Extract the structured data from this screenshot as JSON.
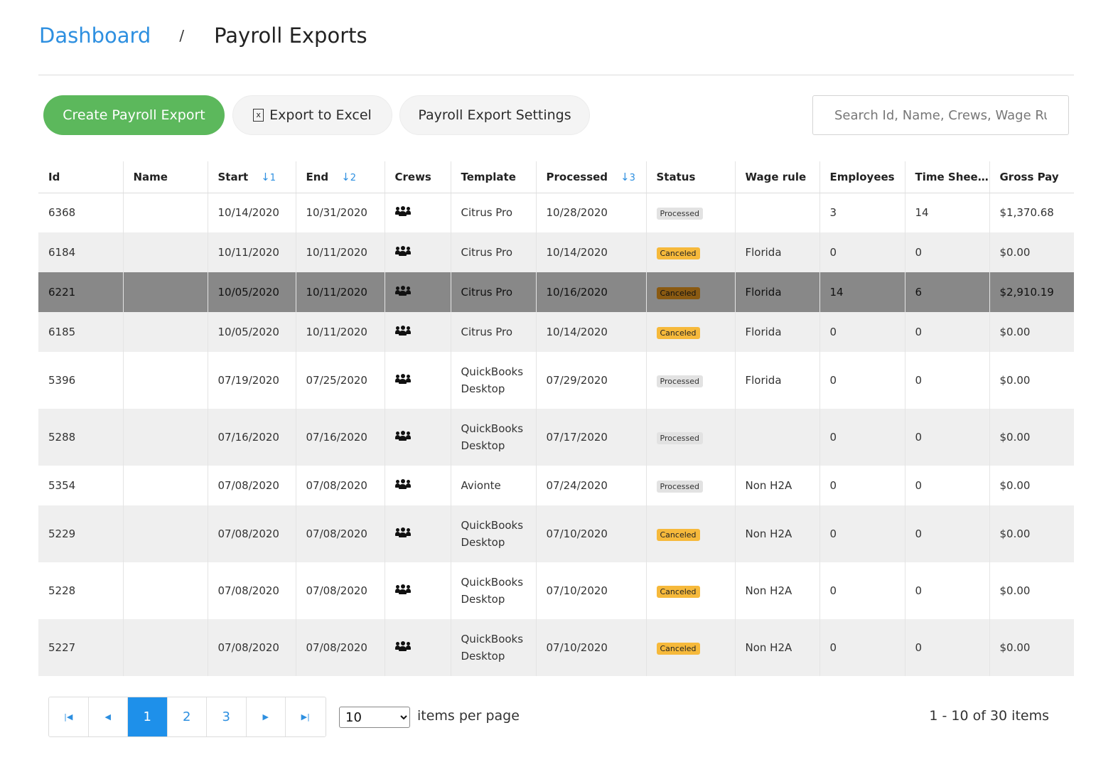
{
  "breadcrumb": {
    "root": "Dashboard",
    "separator": "/",
    "current": "Payroll Exports"
  },
  "toolbar": {
    "create_label": "Create Payroll Export",
    "excel_label": "Export to Excel",
    "excel_icon": "excel-file-icon",
    "settings_label": "Payroll Export Settings",
    "search_placeholder": "Search Id, Name, Crews, Wage Rule"
  },
  "table": {
    "columns": [
      "Id",
      "Name",
      "Start",
      "End",
      "Crews",
      "Template",
      "Processed",
      "Status",
      "Wage rule",
      "Employees",
      "Time Shee...",
      "Gross Pay"
    ],
    "sort": {
      "start": "1",
      "end": "2",
      "processed": "3"
    },
    "crew_icon": "users-icon",
    "rows": [
      {
        "id": "6368",
        "name": "",
        "start": "10/14/2020",
        "end": "10/31/2020",
        "template": [
          "Citrus Pro"
        ],
        "processed": "10/28/2020",
        "status": "Processed",
        "wage_rule": "",
        "employees": "3",
        "timesheets": "14",
        "gross_pay": "$1,370.68"
      },
      {
        "id": "6184",
        "name": "",
        "start": "10/11/2020",
        "end": "10/11/2020",
        "template": [
          "Citrus Pro"
        ],
        "processed": "10/14/2020",
        "status": "Canceled",
        "wage_rule": "Florida",
        "employees": "0",
        "timesheets": "0",
        "gross_pay": "$0.00"
      },
      {
        "id": "6221",
        "name": "",
        "start": "10/05/2020",
        "end": "10/11/2020",
        "template": [
          "Citrus Pro"
        ],
        "processed": "10/16/2020",
        "status": "Canceled",
        "wage_rule": "Florida",
        "employees": "14",
        "timesheets": "6",
        "gross_pay": "$2,910.19"
      },
      {
        "id": "6185",
        "name": "",
        "start": "10/05/2020",
        "end": "10/11/2020",
        "template": [
          "Citrus Pro"
        ],
        "processed": "10/14/2020",
        "status": "Canceled",
        "wage_rule": "Florida",
        "employees": "0",
        "timesheets": "0",
        "gross_pay": "$0.00"
      },
      {
        "id": "5396",
        "name": "",
        "start": "07/19/2020",
        "end": "07/25/2020",
        "template": [
          "QuickBooks",
          "Desktop"
        ],
        "processed": "07/29/2020",
        "status": "Processed",
        "wage_rule": "Florida",
        "employees": "0",
        "timesheets": "0",
        "gross_pay": "$0.00"
      },
      {
        "id": "5288",
        "name": "",
        "start": "07/16/2020",
        "end": "07/16/2020",
        "template": [
          "QuickBooks",
          "Desktop"
        ],
        "processed": "07/17/2020",
        "status": "Processed",
        "wage_rule": "",
        "employees": "0",
        "timesheets": "0",
        "gross_pay": "$0.00"
      },
      {
        "id": "5354",
        "name": "",
        "start": "07/08/2020",
        "end": "07/08/2020",
        "template": [
          "Avionte"
        ],
        "processed": "07/24/2020",
        "status": "Processed",
        "wage_rule": "Non H2A",
        "employees": "0",
        "timesheets": "0",
        "gross_pay": "$0.00"
      },
      {
        "id": "5229",
        "name": "",
        "start": "07/08/2020",
        "end": "07/08/2020",
        "template": [
          "QuickBooks",
          "Desktop"
        ],
        "processed": "07/10/2020",
        "status": "Canceled",
        "wage_rule": "Non H2A",
        "employees": "0",
        "timesheets": "0",
        "gross_pay": "$0.00"
      },
      {
        "id": "5228",
        "name": "",
        "start": "07/08/2020",
        "end": "07/08/2020",
        "template": [
          "QuickBooks",
          "Desktop"
        ],
        "processed": "07/10/2020",
        "status": "Canceled",
        "wage_rule": "Non H2A",
        "employees": "0",
        "timesheets": "0",
        "gross_pay": "$0.00"
      },
      {
        "id": "5227",
        "name": "",
        "start": "07/08/2020",
        "end": "07/08/2020",
        "template": [
          "QuickBooks",
          "Desktop"
        ],
        "processed": "07/10/2020",
        "status": "Canceled",
        "wage_rule": "Non H2A",
        "employees": "0",
        "timesheets": "0",
        "gross_pay": "$0.00"
      }
    ],
    "selected_row_id": "6221"
  },
  "pager": {
    "first_icon": "first-page-icon",
    "prev_icon": "prev-page-icon",
    "next_icon": "next-page-icon",
    "last_icon": "last-page-icon",
    "pages": [
      "1",
      "2",
      "3"
    ],
    "current_page": "1",
    "page_size": "10",
    "page_size_options": [
      "10"
    ],
    "items_per_page_label": "items per page",
    "range_text": "1 - 10 of 30 items"
  },
  "colors": {
    "accent": "#2d8fe0",
    "primary_button": "#5cb85c",
    "selected_row": "#888888",
    "canceled_badge": "#f6b93b",
    "processed_badge": "#e2e2e2"
  }
}
